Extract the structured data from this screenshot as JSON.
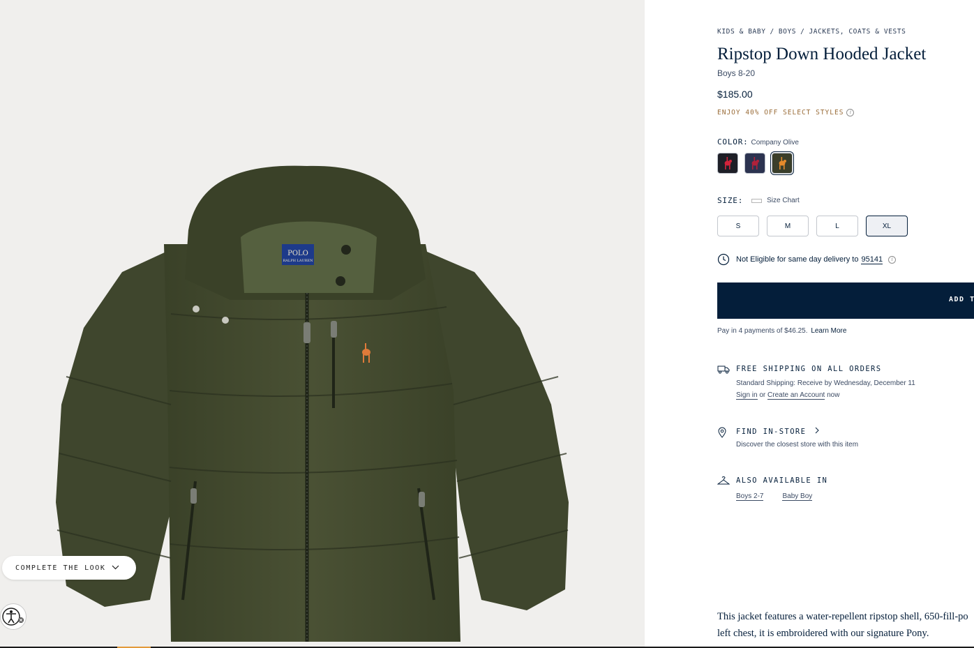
{
  "gallery": {
    "complete_look_label": "COMPLETE THE LOOK",
    "logo_line1": "POLO",
    "logo_line2": "RALPH LAUREN"
  },
  "breadcrumb": [
    "KIDS & BABY",
    "BOYS",
    "JACKETS, COATS & VESTS"
  ],
  "product": {
    "title": "Ripstop Down Hooded Jacket",
    "subtitle": "Boys 8-20",
    "price": "$185.00",
    "promo": "ENJOY 40% OFF SELECT STYLES"
  },
  "color": {
    "label": "COLOR:",
    "selected": "Company Olive",
    "swatches": [
      {
        "bg": "#1e1f27",
        "pony": "#d2233b"
      },
      {
        "bg": "#2c3350",
        "pony": "#b0213a"
      },
      {
        "bg": "#3a3e2a",
        "pony": "#e48a2b"
      }
    ]
  },
  "size": {
    "label": "SIZE:",
    "chart_label": "Size Chart",
    "options": [
      "S",
      "M",
      "L",
      "XL"
    ],
    "selected": "XL"
  },
  "delivery": {
    "text": "Not Eligible for same day delivery to",
    "zip": "95141"
  },
  "cart": {
    "add_label": "ADD TO BAG"
  },
  "payments": {
    "text": "Pay in 4 payments of $46.25.",
    "learn_more": "Learn More"
  },
  "shipping": {
    "heading": "FREE SHIPPING ON ALL ORDERS",
    "detail": "Standard Shipping: Receive by Wednesday, December 11",
    "sign_in": "Sign in",
    "or": "or",
    "create_account": "Create an Account",
    "now": "now"
  },
  "store": {
    "heading": "FIND IN-STORE",
    "detail": "Discover the closest store with this item"
  },
  "also": {
    "heading": "ALSO AVAILABLE IN",
    "links": [
      "Boys 2-7",
      "Baby Boy"
    ]
  },
  "description": {
    "line1": "This jacket features a water-repellent ripstop shell, 650-fill-po",
    "line2": "left chest, it is embroidered with our signature Pony."
  }
}
